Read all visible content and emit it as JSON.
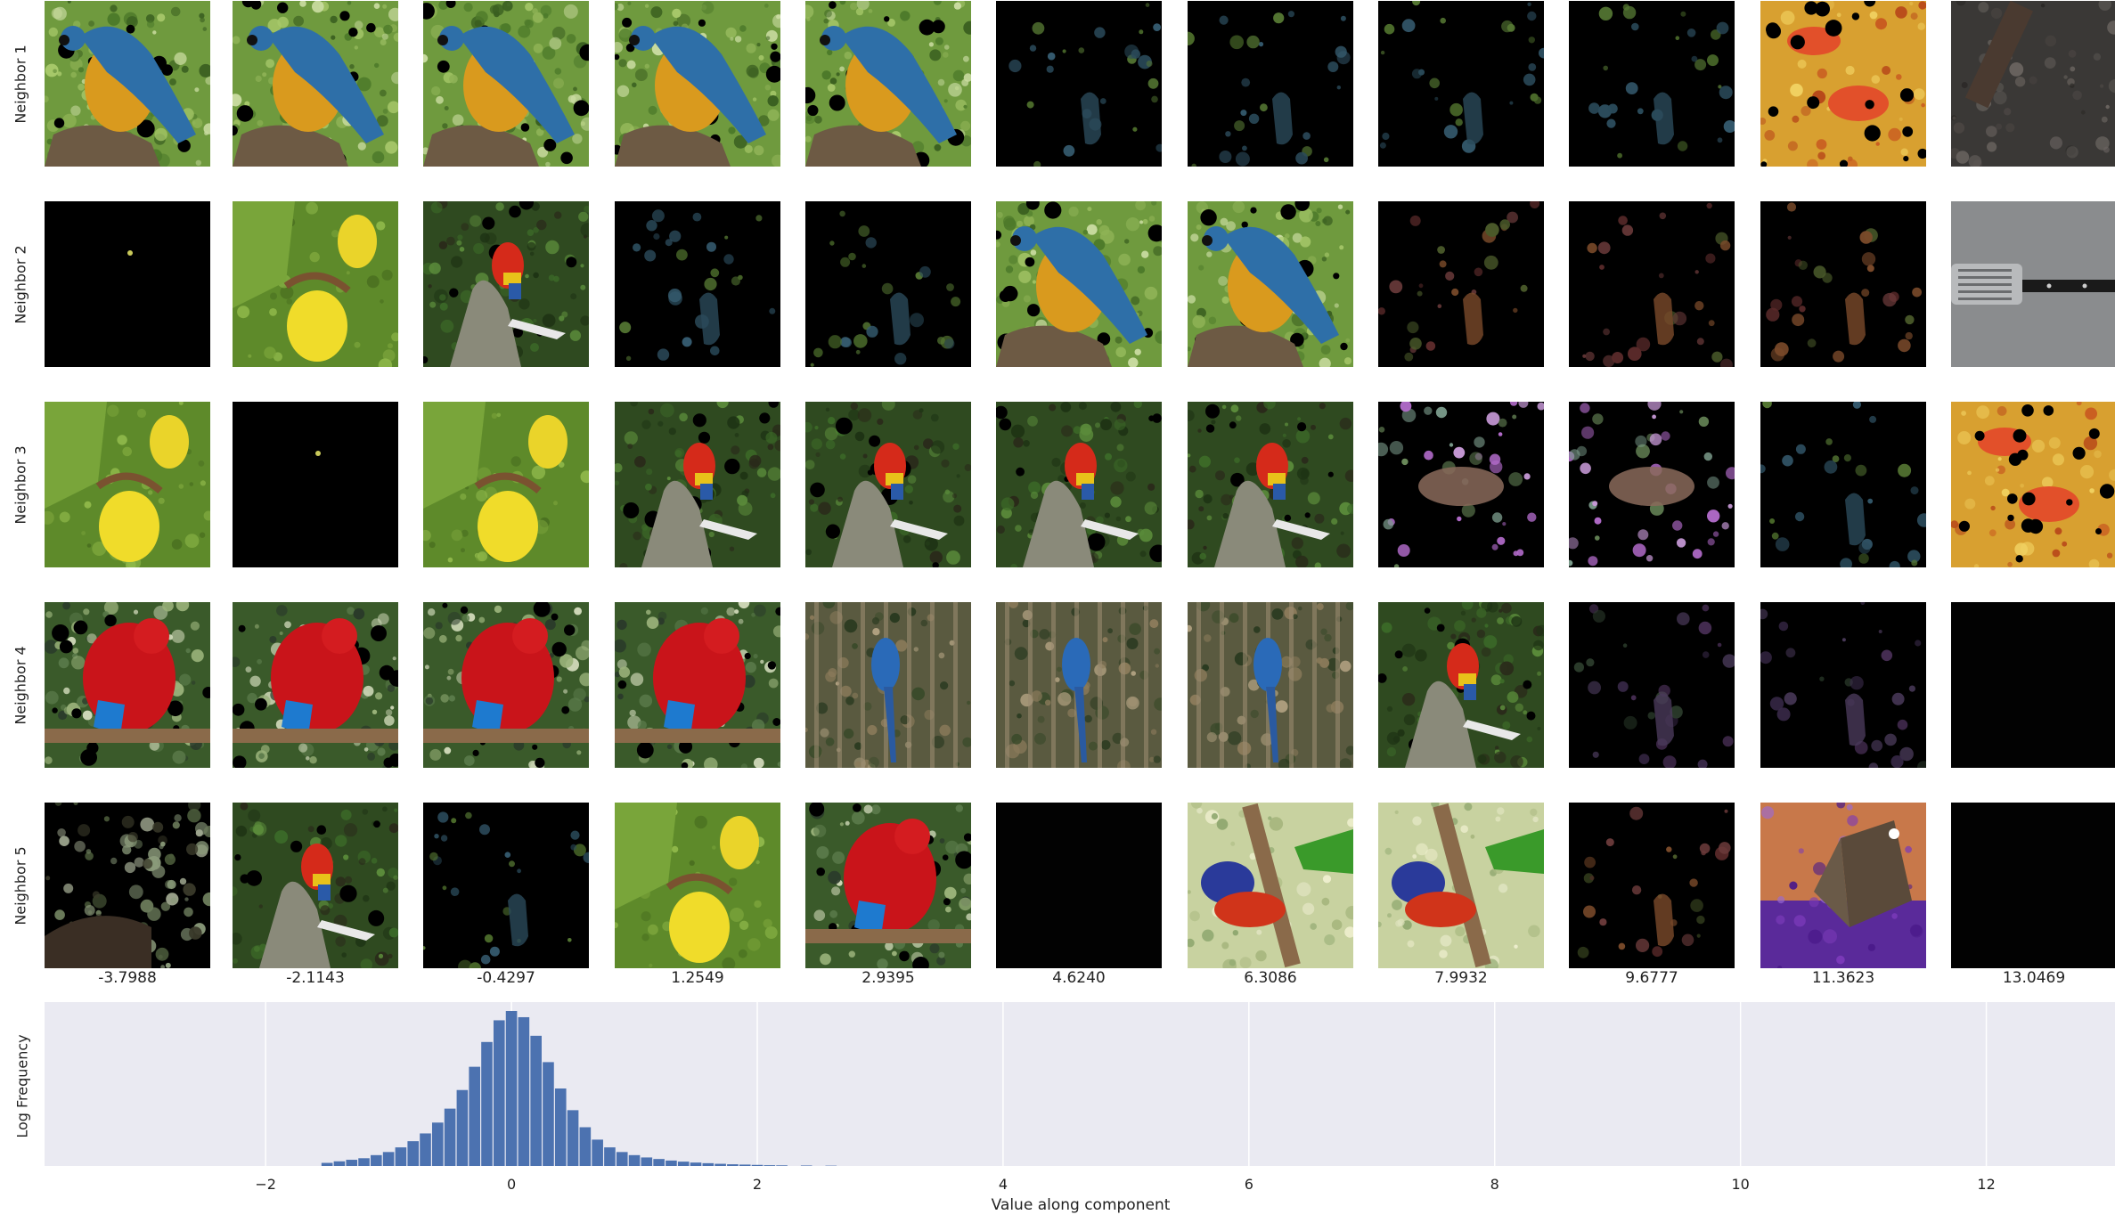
{
  "grid": {
    "row_labels": [
      "Neighbor 1",
      "Neighbor 2",
      "Neighbor 3",
      "Neighbor 4",
      "Neighbor 5"
    ],
    "column_values": [
      "-3.7988",
      "-2.1143",
      "-0.4297",
      "1.2549",
      "2.9395",
      "4.6240",
      "6.3086",
      "7.9932",
      "9.6777",
      "11.3623",
      "13.0469"
    ],
    "tiles": [
      [
        "macaw-blue-gold",
        "macaw-blue-gold",
        "macaw-blue-gold",
        "macaw-blue-gold",
        "macaw-blue-gold",
        "dark-sparse-green",
        "dark-sparse-green",
        "dark-sparse-green",
        "dark-sparse-green",
        "pizza",
        "dark-metal"
      ],
      [
        "black-dot",
        "yellow-orchid",
        "scarlet-macaw-branch",
        "dark-sparse-green",
        "dark-sparse-green",
        "macaw-blue-gold",
        "macaw-blue-gold",
        "dark-sparse-red",
        "dark-sparse-red",
        "dark-sparse-red",
        "spatula-gray"
      ],
      [
        "yellow-orchid",
        "black-dot",
        "yellow-orchid",
        "scarlet-macaw-branch",
        "scarlet-macaw-branch",
        "scarlet-macaw-branch",
        "scarlet-macaw-branch",
        "dark-butterfly-purple",
        "dark-butterfly-purple",
        "dark-sparse-green",
        "pizza"
      ],
      [
        "red-macaw",
        "red-macaw",
        "red-macaw",
        "red-macaw",
        "blue-macaw-forest",
        "blue-macaw-forest",
        "blue-macaw-forest",
        "scarlet-macaw-branch",
        "dark-sparse-purple",
        "dark-sparse-purple",
        "black"
      ],
      [
        "dark-plants",
        "scarlet-macaw-branch",
        "dark-sparse-green",
        "yellow-orchid",
        "red-macaw",
        "black",
        "lorikeet-branch",
        "lorikeet-branch",
        "dark-sparse-red",
        "butterfly-purple",
        "black"
      ]
    ]
  },
  "chart_data": {
    "type": "bar",
    "title": "",
    "xlabel": "Value along component",
    "ylabel": "Log Frequency",
    "xlim": [
      -3.7988,
      13.0469
    ],
    "xticks": [
      -2,
      0,
      2,
      4,
      6,
      8,
      10,
      12
    ],
    "xtick_labels": [
      "−2",
      "0",
      "2",
      "4",
      "6",
      "8",
      "10",
      "12"
    ],
    "grid": true,
    "bin_width": 0.1,
    "bins": [
      {
        "x": -1.5,
        "v": 0.02
      },
      {
        "x": -1.4,
        "v": 0.03
      },
      {
        "x": -1.3,
        "v": 0.04
      },
      {
        "x": -1.2,
        "v": 0.05
      },
      {
        "x": -1.1,
        "v": 0.07
      },
      {
        "x": -1.0,
        "v": 0.09
      },
      {
        "x": -0.9,
        "v": 0.12
      },
      {
        "x": -0.8,
        "v": 0.16
      },
      {
        "x": -0.7,
        "v": 0.21
      },
      {
        "x": -0.6,
        "v": 0.28
      },
      {
        "x": -0.5,
        "v": 0.37
      },
      {
        "x": -0.4,
        "v": 0.49
      },
      {
        "x": -0.3,
        "v": 0.64
      },
      {
        "x": -0.2,
        "v": 0.8
      },
      {
        "x": -0.1,
        "v": 0.94
      },
      {
        "x": 0.0,
        "v": 1.0
      },
      {
        "x": 0.1,
        "v": 0.96
      },
      {
        "x": 0.2,
        "v": 0.84
      },
      {
        "x": 0.3,
        "v": 0.67
      },
      {
        "x": 0.4,
        "v": 0.5
      },
      {
        "x": 0.5,
        "v": 0.36
      },
      {
        "x": 0.6,
        "v": 0.25
      },
      {
        "x": 0.7,
        "v": 0.17
      },
      {
        "x": 0.8,
        "v": 0.12
      },
      {
        "x": 0.9,
        "v": 0.09
      },
      {
        "x": 1.0,
        "v": 0.07
      },
      {
        "x": 1.1,
        "v": 0.055
      },
      {
        "x": 1.2,
        "v": 0.045
      },
      {
        "x": 1.3,
        "v": 0.035
      },
      {
        "x": 1.4,
        "v": 0.028
      },
      {
        "x": 1.5,
        "v": 0.022
      },
      {
        "x": 1.6,
        "v": 0.018
      },
      {
        "x": 1.7,
        "v": 0.014
      },
      {
        "x": 1.8,
        "v": 0.011
      },
      {
        "x": 1.9,
        "v": 0.009
      },
      {
        "x": 2.0,
        "v": 0.007
      },
      {
        "x": 2.1,
        "v": 0.005
      },
      {
        "x": 2.2,
        "v": 0.004
      },
      {
        "x": 2.4,
        "v": 0.003
      },
      {
        "x": 2.6,
        "v": 0.002
      }
    ],
    "colors": {
      "bar": "#4c72b0",
      "background": "#eaeaf2",
      "grid": "#ffffff"
    }
  }
}
